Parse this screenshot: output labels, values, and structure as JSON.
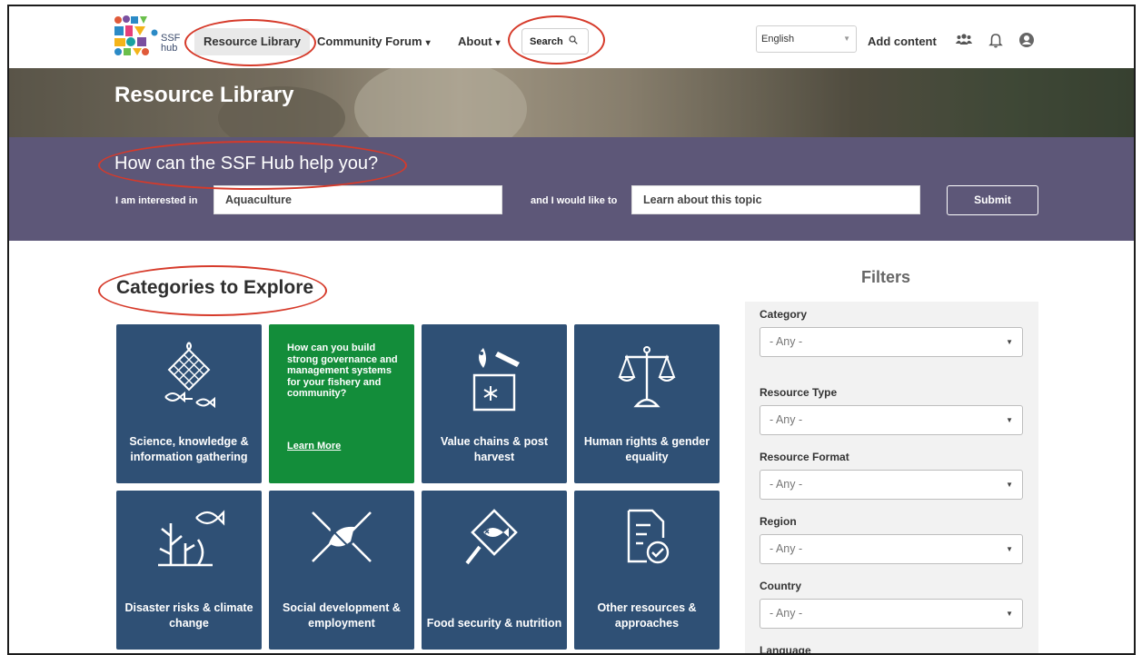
{
  "header": {
    "logo_text_1": "SSF",
    "logo_text_2": "hub",
    "nav": {
      "resource_library": "Resource Library",
      "community_forum": "Community Forum",
      "about": "About",
      "caret": "▾"
    },
    "search_label": "Search",
    "search_icon": "magnifier-icon",
    "language": "English",
    "add_content": "Add content",
    "icons": [
      "people-icon",
      "bell-icon",
      "user-circle-icon"
    ]
  },
  "hero": {
    "title": "Resource Library"
  },
  "help": {
    "question": "How can the SSF Hub help you?",
    "interest_label": "I am interested in",
    "interest_value": "Aquaculture",
    "goal_label": "and I would like to",
    "goal_value": "Learn about this topic",
    "submit": "Submit"
  },
  "categories": {
    "title": "Categories to Explore",
    "tiles": [
      {
        "label": "Science, knowledge & information gathering",
        "icon": "fishing-net-icon"
      },
      {
        "text": "How can you build strong governance and management systems for your fishery and community?",
        "link": "Learn More"
      },
      {
        "label": "Value chains & post harvest",
        "icon": "fish-cooler-icon"
      },
      {
        "label": "Human rights & gender equality",
        "icon": "scales-icon"
      },
      {
        "label": "Disaster risks & climate change",
        "icon": "coral-fish-icon"
      },
      {
        "label": "Social development & employment",
        "icon": "hands-together-icon"
      },
      {
        "label": "Food security & nutrition",
        "icon": "fish-plate-icon"
      },
      {
        "label": "Other resources & approaches",
        "icon": "document-check-icon"
      }
    ]
  },
  "filters": {
    "title": "Filters",
    "any": "- Any -",
    "dropdown_symbol": "▼",
    "fields": [
      "Category",
      "Resource Type",
      "Resource Format",
      "Region",
      "Country",
      "Language"
    ]
  },
  "colors": {
    "tile_blue": "#2f5075",
    "tile_green": "#138d3a",
    "help_band": "#5d5778",
    "annotation_red": "#d63a2a"
  }
}
